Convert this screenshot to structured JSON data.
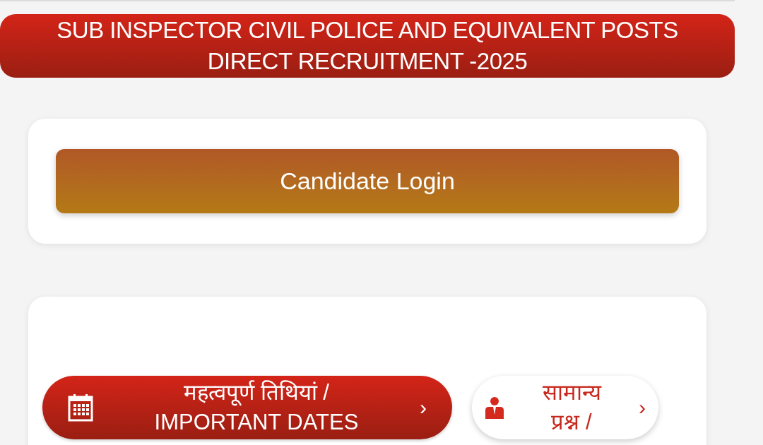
{
  "banner": {
    "lines": [
      "SUB INSPECTOR CIVIL POLICE AND EQUIVALENT POSTS",
      "DIRECT RECRUITMENT -2025"
    ]
  },
  "login": {
    "label": "Candidate Login"
  },
  "links": [
    {
      "kind": "primary",
      "lines": [
        "महत्वपूर्ण तिथियां /",
        "IMPORTANT DATES"
      ],
      "chevron": "›"
    },
    {
      "kind": "secondary",
      "lines": [
        "सामान्य",
        "प्रश्न /"
      ],
      "chevron": "›"
    }
  ]
}
